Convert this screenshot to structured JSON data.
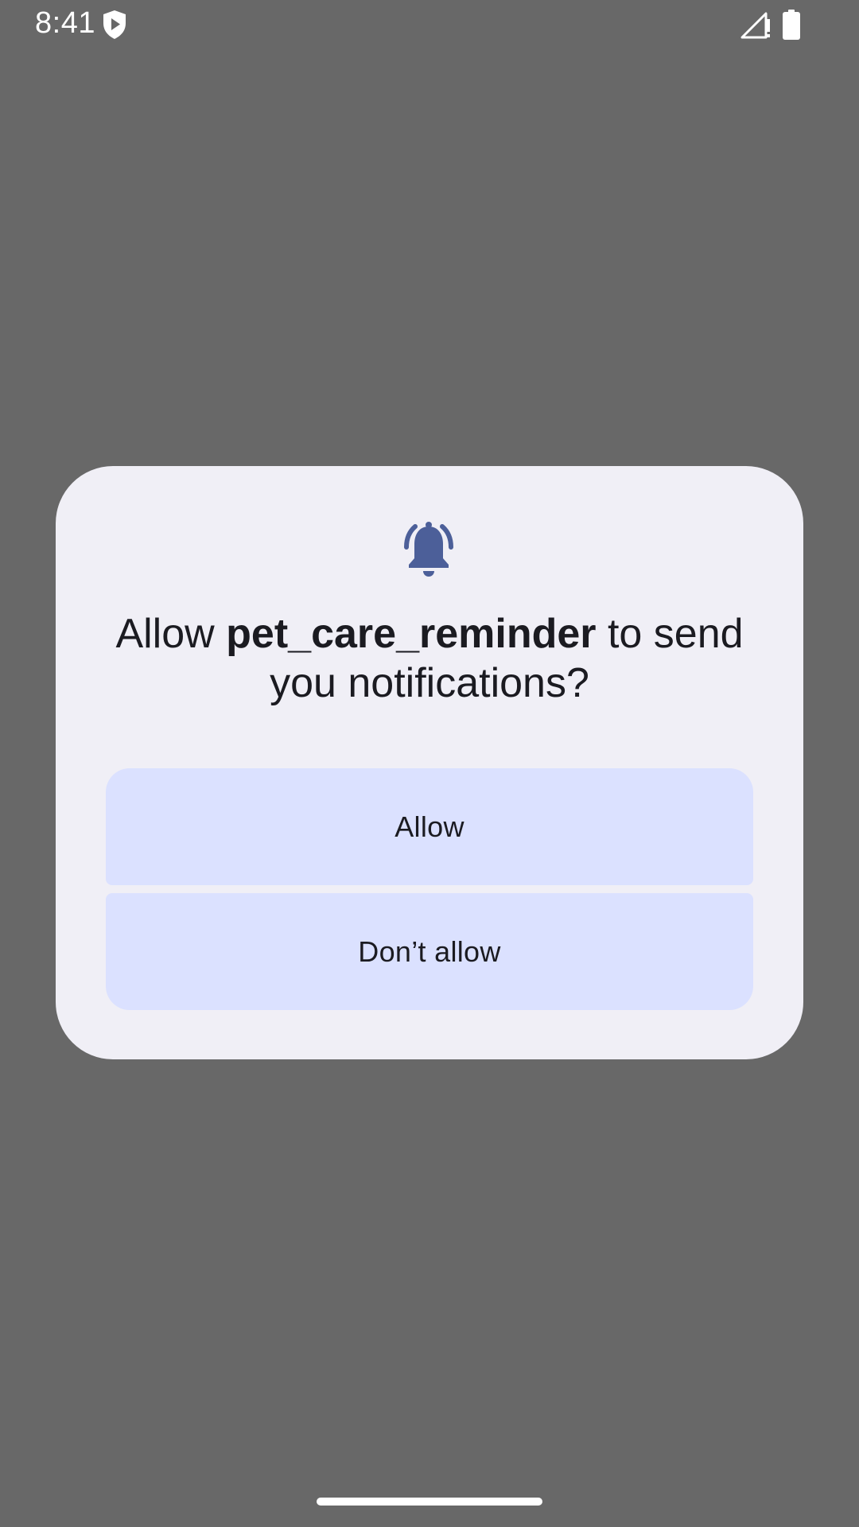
{
  "status_bar": {
    "time": "8:41",
    "icons": [
      "shield-play-icon",
      "signal-alert-icon",
      "battery-icon"
    ]
  },
  "dialog": {
    "icon": "bell-ring-icon",
    "title_prefix": "Allow ",
    "app_name": "pet_care_reminder",
    "title_suffix": " to send you notifications?",
    "allow_label": "Allow",
    "deny_label": "Don’t allow"
  },
  "colors": {
    "scrim": "#686868",
    "dialog_bg": "#f0eff6",
    "button_bg": "#dbe1ff",
    "icon_accent": "#4c5f99",
    "text": "#1b1b21"
  }
}
